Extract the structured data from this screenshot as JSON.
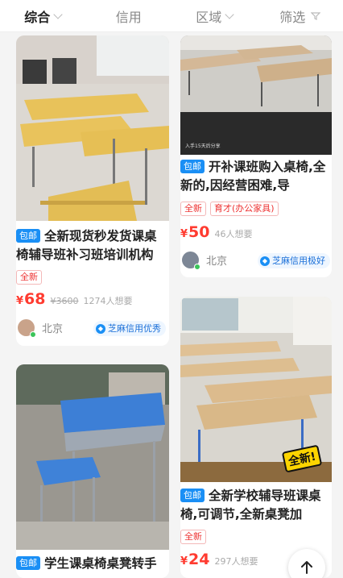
{
  "filter_bar": {
    "tabs": [
      {
        "label": "综合"
      },
      {
        "label": "信用"
      },
      {
        "label": "区域"
      },
      {
        "label": "筛选"
      }
    ]
  },
  "cards": [
    {
      "badge": "包邮",
      "title": "全新现货秒发货课桌椅辅导班补习班培训机构",
      "tags": [
        "全新"
      ],
      "currency": "¥",
      "price": "68",
      "original_price": "¥3600",
      "want": "1274人想要",
      "city": "北京",
      "credit": "芝麻信用优秀"
    },
    {
      "badge": "包邮",
      "title": "开补课班购入桌椅,全新的,因经营困难,导",
      "tags": [
        "全新",
        "育才(办公家具)"
      ],
      "currency": "¥",
      "price": "50",
      "want": "46人想要",
      "city": "北京",
      "credit": "芝麻信用极好",
      "image_caption": "入手15天后分享"
    },
    {
      "badge": "包邮",
      "title": "学生课桌椅桌凳转手"
    },
    {
      "badge": "包邮",
      "title": "全新学校辅导班课桌椅,可调节,全新桌凳加",
      "tags": [
        "全新"
      ],
      "currency": "¥",
      "price": "24",
      "want": "297人想要",
      "image_sticker": "全新!"
    }
  ],
  "colors": {
    "accent_blue": "#1a8ff5",
    "price_red": "#ff3b30",
    "tag_red": "#e33333"
  }
}
